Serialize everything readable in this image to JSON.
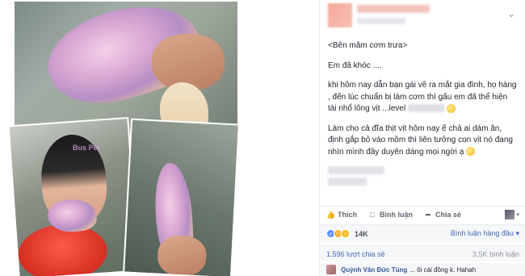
{
  "post": {
    "paragraphs": [
      "<Bên mâm cơm trưa>",
      "Em đã khóc ....",
      "khi hôm nay dẫn bạn gái về ra mắt gia đình, họ hàng , đến lúc chuẩn bị làm cơm thì gấu em đã thể hiện tài nhổ lông vịt ...level",
      "Làm cho cả đĩa thịt vịt hôm nay ế chả ai dám ăn, định gắp bỏ vào mồm thì liên tưởng con vịt nó đang nhìn mình đầy duyên dáng mọi ngời ạ"
    ]
  },
  "actions": {
    "like": "Thích",
    "comment": "Bình luận",
    "share": "Chia sẻ"
  },
  "reactions": {
    "count": "14K",
    "sort_label": "Bình luận hàng đầu"
  },
  "stats": {
    "shares": "1.596 lượt chia sẻ",
    "views": "3,5K bình luận"
  },
  "comment_preview": {
    "name": "Quỳnh Vân Đức Tùng",
    "text": "... ôi cái đồng k. Hahah"
  },
  "photos": {
    "watermark": "Bus Pet"
  },
  "colors": {
    "link": "#4267b2",
    "like_blue": "#5890ff",
    "text": "#1d2129",
    "muted": "#606770"
  }
}
